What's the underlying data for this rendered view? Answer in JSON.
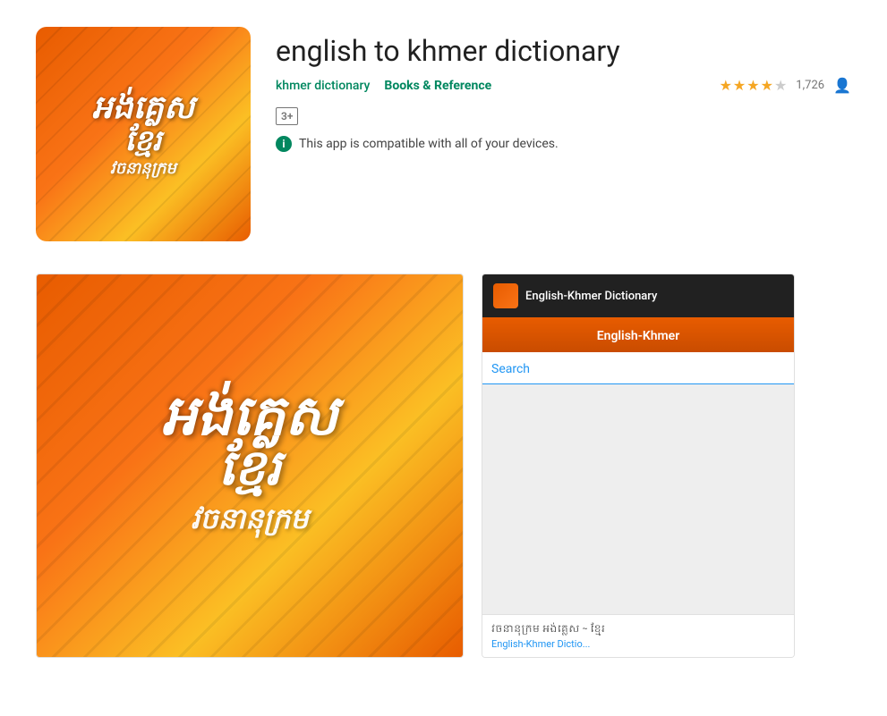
{
  "app": {
    "title": "english to khmer dictionary",
    "developer": "khmer dictionary",
    "category": "Books & Reference",
    "rating_value": 4,
    "rating_max": 5,
    "rating_count": "1,726",
    "age_rating": "3+",
    "compatibility_text": "This app is compatible with all of your devices.",
    "icon_line1": "អង់គ្លេស",
    "icon_line2": "ខ្មែរ",
    "icon_line3": "វចនានុក្រម"
  },
  "screenshot1": {
    "line1": "អង់គ្លេស",
    "line2": "ខ្មែរ",
    "line3": "វចនានុក្រម"
  },
  "screenshot2": {
    "topbar_title": "English-Khmer Dictionary",
    "tab_label": "English-Khmer",
    "search_placeholder": "Search",
    "footer_line1": "វចនានុក្រម អង់គ្លេស ~ ខ្មែរ",
    "footer_line2": "English-Khmer Dictio..."
  },
  "stars": {
    "filled": 4,
    "empty": 1
  }
}
